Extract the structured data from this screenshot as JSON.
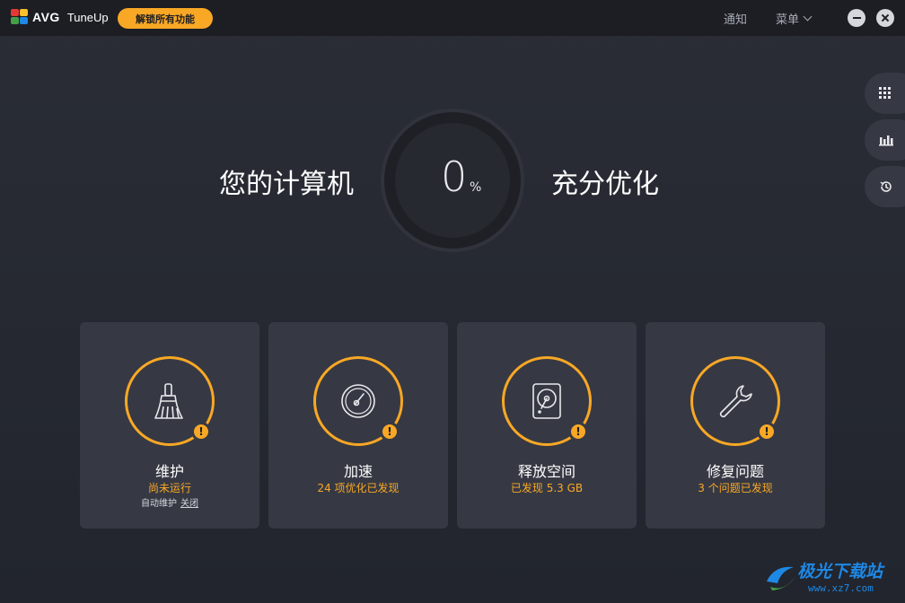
{
  "app": {
    "brand": "AVG",
    "product": "TuneUp",
    "unlock_label": "解锁所有功能",
    "notify_label": "通知",
    "menu_label": "菜单",
    "accent": "#f9a825"
  },
  "hero": {
    "left_text": "您的计算机",
    "right_text": "充分优化",
    "percent_value": "0",
    "percent_unit": "%"
  },
  "rail": [
    {
      "icon": "grid-icon"
    },
    {
      "icon": "bar-chart-icon"
    },
    {
      "icon": "history-icon"
    }
  ],
  "cards": [
    {
      "icon": "broom-icon",
      "title": "维护",
      "status": "尚未运行",
      "sub_label": "自动维护",
      "sub_link": "关闭"
    },
    {
      "icon": "speedometer-icon",
      "title": "加速",
      "status": "24 项优化已发现"
    },
    {
      "icon": "hard-drive-icon",
      "title": "释放空间",
      "status": "已发现 5.3 GB"
    },
    {
      "icon": "wrench-icon",
      "title": "修复问题",
      "status": "3 个问题已发现"
    }
  ],
  "watermark": {
    "text": "极光下载站",
    "url": "www.xz7.com"
  }
}
